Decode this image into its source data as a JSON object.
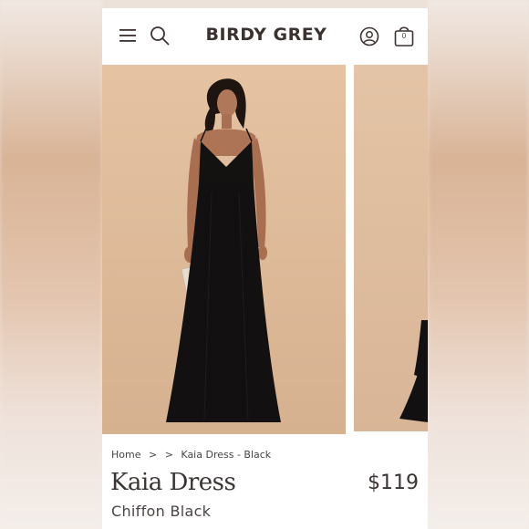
{
  "header": {
    "brand": "BIRDY GREY",
    "bag_count": "0",
    "icons": [
      "menu-icon",
      "search-icon",
      "account-icon",
      "shopping-bag-icon"
    ]
  },
  "gallery": {
    "images": [
      "model-front-black-dress",
      "model-side-black-dress"
    ]
  },
  "breadcrumb": {
    "home": "Home",
    "sep1": ">",
    "sep2": ">",
    "current": "Kaia Dress - Black"
  },
  "product": {
    "title": "Kaia Dress",
    "price": "$119",
    "variant": "Chiffon Black"
  },
  "colors": {
    "background_beige": "#dcb897",
    "dress_black": "#121010",
    "text_dark": "#3a3533"
  }
}
